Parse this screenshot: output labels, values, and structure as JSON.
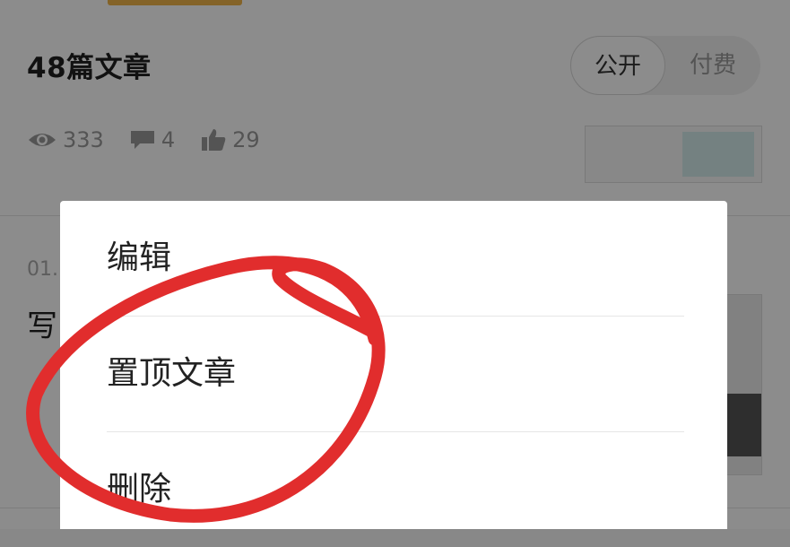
{
  "header": {
    "article_count_title": "48篇文章"
  },
  "visibility_toggle": {
    "public_label": "公开",
    "paid_label": "付费"
  },
  "stats": {
    "views": "333",
    "comments": "4",
    "likes": "29"
  },
  "article_list": {
    "items": [
      {
        "date": "01.",
        "title": "写"
      }
    ]
  },
  "context_menu": {
    "items": [
      {
        "label": "编辑"
      },
      {
        "label": "置顶文章"
      },
      {
        "label": "删除"
      }
    ]
  },
  "annotation": {
    "color": "#e12d2d"
  },
  "colors": {
    "toggle_bg": "#f0f0f0",
    "accent_sliver": "#f0b54a"
  },
  "icons": [
    "eye-icon",
    "comment-icon",
    "thumbs-up-icon"
  ]
}
